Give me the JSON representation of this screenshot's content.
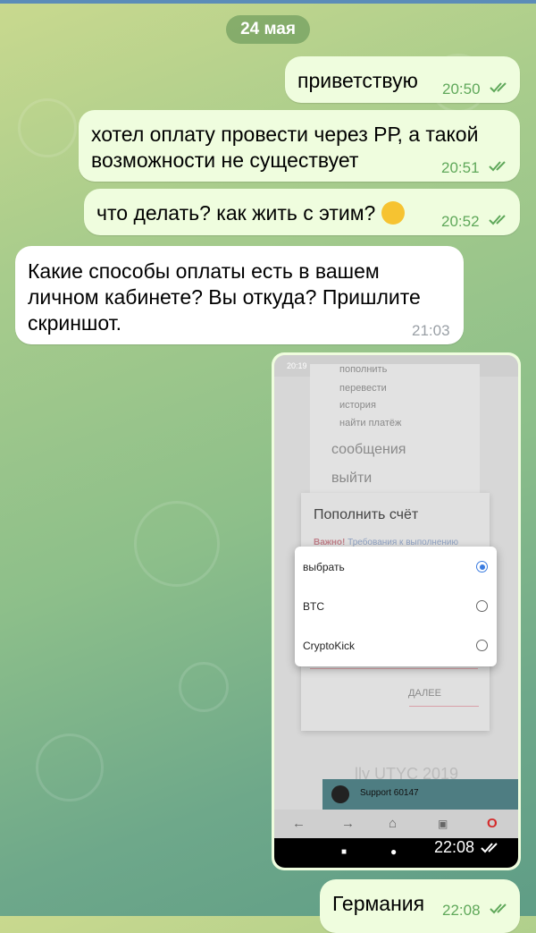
{
  "date_label": "24 мая",
  "messages": [
    {
      "text": "приветствую",
      "time": "20:50"
    },
    {
      "line1": "хотел оплату провести через РР, а такой",
      "line2": "возможности не существует",
      "time": "20:51"
    },
    {
      "text": "что делать? как жить с этим?",
      "time": "20:52",
      "emoji": "crying-face-icon"
    },
    {
      "line1": "Какие способы оплаты есть в вашем",
      "line2": "личном кабинете? Вы откуда? Пришлите",
      "line3": "скриншот.",
      "time": "21:03"
    },
    {
      "time": "22:08"
    },
    {
      "text": "Германия",
      "time": "22:08"
    }
  ],
  "screenshot": {
    "status_time": "20:19",
    "menu_items": [
      "пополнить",
      "перевести",
      "история",
      "найти платёж",
      "сообщения",
      "выйти"
    ],
    "dialog_title": "Пополнить счёт",
    "warning_red": "Важно!",
    "warning_blue": "Требования к выполнению",
    "options": [
      "выбрать",
      "BTC",
      "CryptoKick"
    ],
    "selected_option": "выбрать",
    "next_button": "ДАЛЕЕ",
    "support_label": "Support 60147",
    "faded_footer": "lly UTYC 2019"
  },
  "colors": {
    "outgoing_bubble": "#effdde",
    "incoming_bubble": "#ffffff",
    "time_outgoing": "#5fa85a",
    "radio_selected": "#3a7be0"
  }
}
